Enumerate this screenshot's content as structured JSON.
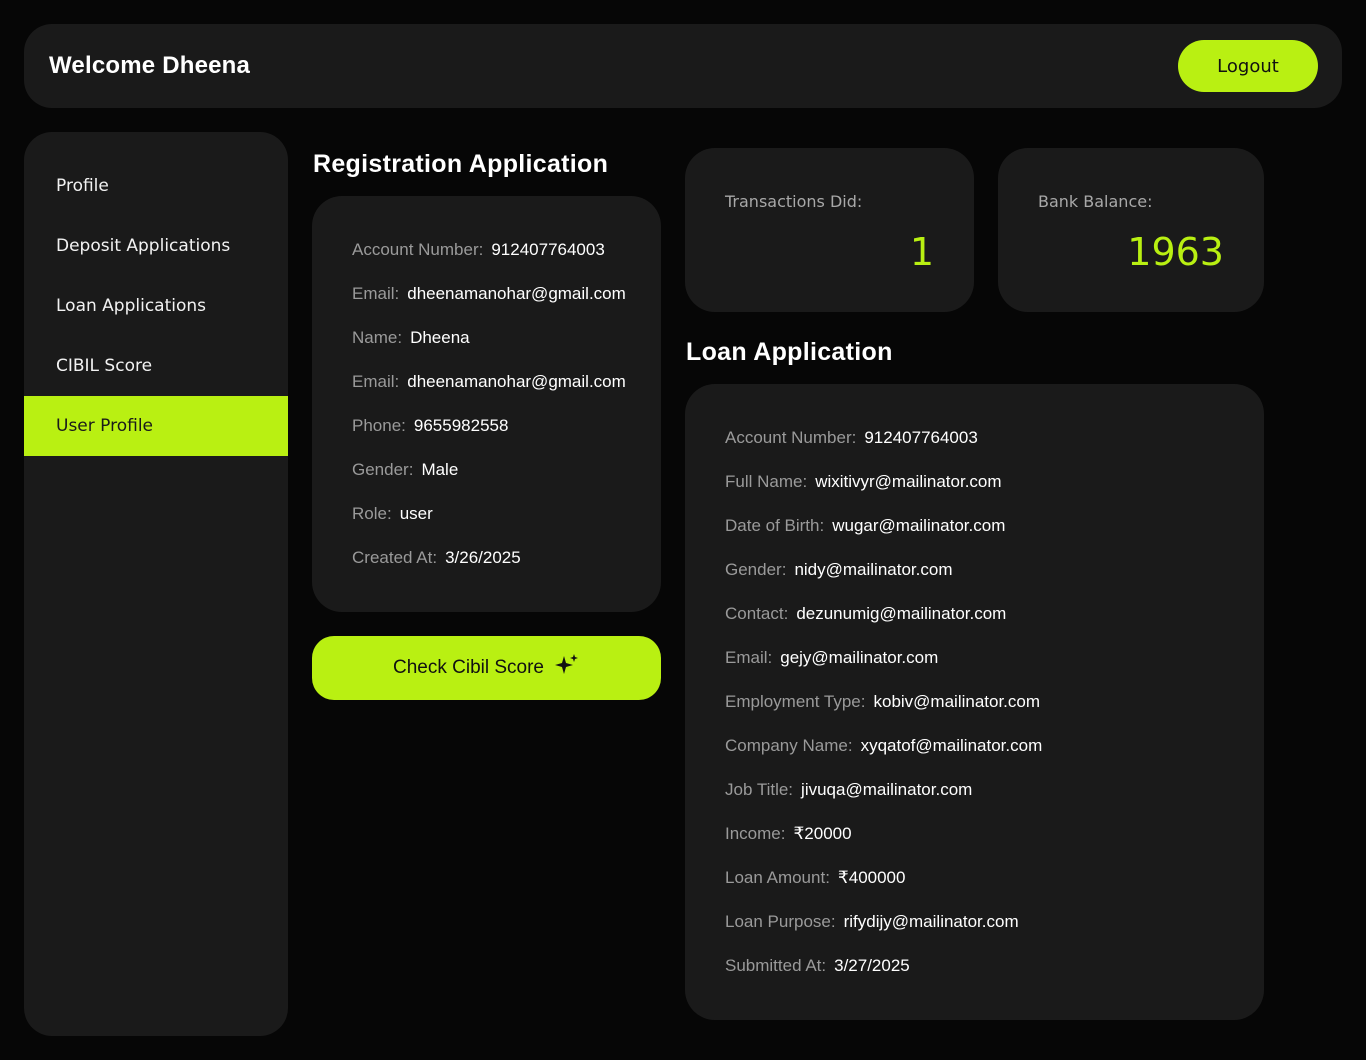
{
  "header": {
    "title": "Welcome Dheena",
    "logout_label": "Logout"
  },
  "sidebar": {
    "items": [
      {
        "label": "Profile",
        "active": false
      },
      {
        "label": "Deposit Applications",
        "active": false
      },
      {
        "label": "Loan Applications",
        "active": false
      },
      {
        "label": "CIBIL Score",
        "active": false
      },
      {
        "label": "User Profile",
        "active": true
      }
    ]
  },
  "registration": {
    "title": "Registration Application",
    "fields": [
      {
        "label": "Account Number:",
        "value": "912407764003"
      },
      {
        "label": "Email:",
        "value": "dheenamanohar@gmail.com"
      },
      {
        "label": "Name:",
        "value": "Dheena"
      },
      {
        "label": "Email:",
        "value": "dheenamanohar@gmail.com"
      },
      {
        "label": "Phone:",
        "value": "9655982558"
      },
      {
        "label": "Gender:",
        "value": "Male"
      },
      {
        "label": "Role:",
        "value": "user"
      },
      {
        "label": "Created At:",
        "value": "3/26/2025"
      }
    ],
    "check_cibil_label": "Check Cibil Score",
    "check_cibil_icon": "sparkle-icon"
  },
  "stats": {
    "transactions": {
      "label": "Transactions Did:",
      "value": "1"
    },
    "balance": {
      "label": "Bank Balance:",
      "value": "1963"
    }
  },
  "loan": {
    "title": "Loan Application",
    "fields": [
      {
        "label": "Account Number:",
        "value": "912407764003"
      },
      {
        "label": "Full Name:",
        "value": "wixitivyr@mailinator.com"
      },
      {
        "label": "Date of Birth:",
        "value": "wugar@mailinator.com"
      },
      {
        "label": "Gender:",
        "value": "nidy@mailinator.com"
      },
      {
        "label": "Contact:",
        "value": "dezunumig@mailinator.com"
      },
      {
        "label": "Email:",
        "value": "gejy@mailinator.com"
      },
      {
        "label": "Employment Type:",
        "value": "kobiv@mailinator.com"
      },
      {
        "label": "Company Name:",
        "value": "xyqatof@mailinator.com"
      },
      {
        "label": "Job Title:",
        "value": "jivuqa@mailinator.com"
      },
      {
        "label": "Income:",
        "value": "₹20000"
      },
      {
        "label": "Loan Amount:",
        "value": "₹400000"
      },
      {
        "label": "Loan Purpose:",
        "value": "rifydijy@mailinator.com"
      },
      {
        "label": "Submitted At:",
        "value": "3/27/2025"
      }
    ]
  },
  "colors": {
    "accent": "#b9f012",
    "background": "#060606",
    "card": "#1a1a1a",
    "label": "#9a9a9a"
  }
}
